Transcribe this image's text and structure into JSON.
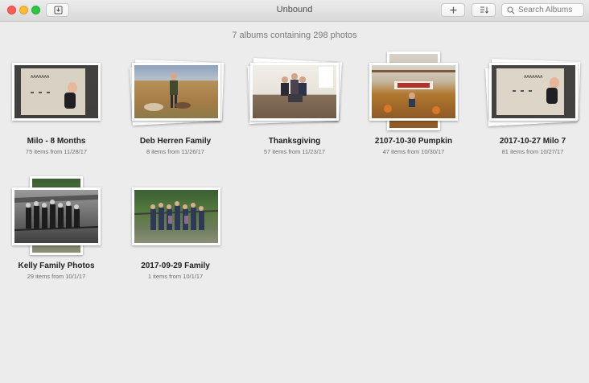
{
  "window": {
    "title": "Unbound"
  },
  "toolbar": {
    "import_icon": "import-icon",
    "add_icon": "plus-icon",
    "sort_icon": "sort-icon",
    "search_placeholder": "Search Albums"
  },
  "summary": "7 albums containing 298 photos",
  "albums": [
    {
      "name": "Milo - 8 Months",
      "meta": "75 items from 11/28/17",
      "thumb": "baby-on-blanket"
    },
    {
      "name": "Deb Herren Family",
      "meta": "8 items from 11/26/17",
      "thumb": "woman-with-dogs-in-field"
    },
    {
      "name": "Thanksgiving",
      "meta": "57 items from 11/23/17",
      "thumb": "family-on-floor"
    },
    {
      "name": "2107-10-30 Pumpkin",
      "meta": "47 items from 10/30/17",
      "thumb": "pumpkin-patch"
    },
    {
      "name": "2017-10-27 Milo 7",
      "meta": "81 items from 10/27/17",
      "thumb": "baby-on-blanket"
    },
    {
      "name": "Kelly Family Photos",
      "meta": "29 items from 10/1/17",
      "thumb": "family-on-bridge-bw"
    },
    {
      "name": "2017-09-29 Family",
      "meta": "1 items from 10/1/17",
      "thumb": "family-on-bridge"
    }
  ]
}
